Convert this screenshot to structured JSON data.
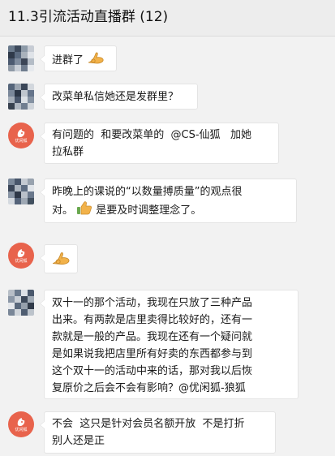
{
  "header": {
    "title": "11.3引流活动直播群 (12)"
  },
  "logo_text": "优闲狐",
  "colors": {
    "logo": "#e8634c",
    "background": "#f2f2f2",
    "bubble": "#ffffff"
  },
  "messages": [
    {
      "avatar": "mosaic",
      "text": "进群了",
      "emoji": "ok-hand-icon"
    },
    {
      "avatar": "mosaic",
      "text": "改菜单私信她还是发群里？"
    },
    {
      "avatar": "logo",
      "line1": "有问题的  和要改菜单的  @CS-仙狐   加她",
      "line2": "拉私群"
    },
    {
      "avatar": "mosaic",
      "line1": "昨晚上的课说的“以数量搏质量”的观点很",
      "line2a": "对。",
      "line2b": "是要及时调整理念了。",
      "emoji": "thumbs-up-icon"
    },
    {
      "avatar": "logo",
      "emoji": "ok-hand-icon"
    },
    {
      "avatar": "mosaic",
      "lines": [
        "双十一的那个活动，我现在只放了三种产品",
        "出来。有两款是店里卖得比较好的，还有一",
        "款就是一般的产品。我现在还有一个疑问就",
        "是如果说我把店里所有好卖的东西都参与到",
        "这个双十一的活动中来的话，那对我以后恢",
        "复原价之后会不会有影响？@优闲狐-狼狐"
      ]
    },
    {
      "avatar": "logo",
      "line1": "不会  这只是针对会员名额开放  不是打折",
      "line2": "别人还是正"
    }
  ]
}
